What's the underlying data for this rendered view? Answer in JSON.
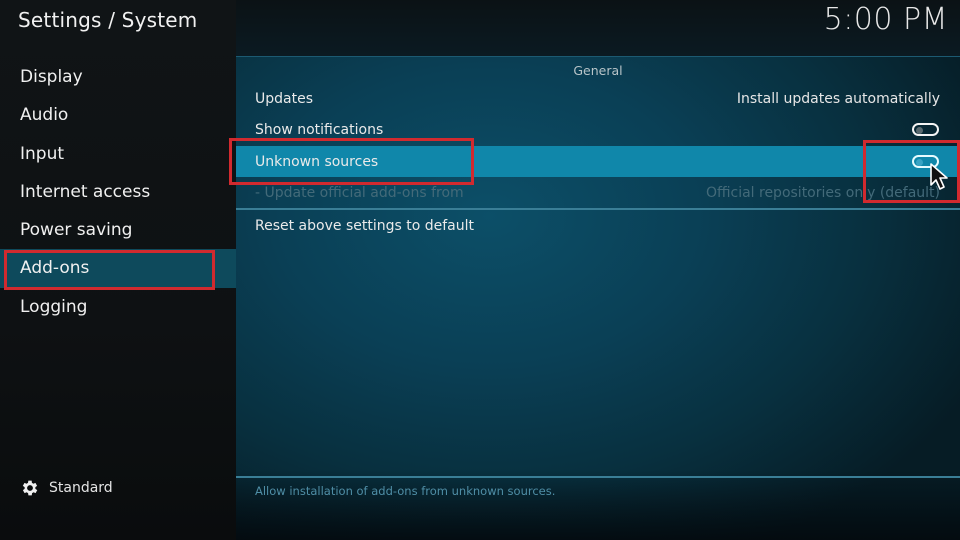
{
  "header": {
    "title": "Settings / System",
    "clock": "5:00 PM"
  },
  "sidebar": {
    "items": [
      {
        "label": "Display",
        "active": false
      },
      {
        "label": "Audio",
        "active": false
      },
      {
        "label": "Input",
        "active": false
      },
      {
        "label": "Internet access",
        "active": false
      },
      {
        "label": "Power saving",
        "active": false
      },
      {
        "label": "Add-ons",
        "active": true
      },
      {
        "label": "Logging",
        "active": false
      }
    ],
    "settings_level": {
      "icon": "gear-icon",
      "label": "Standard"
    }
  },
  "main": {
    "section_header": "General",
    "rows": [
      {
        "label": "Updates",
        "value": "Install updates automatically",
        "type": "select"
      },
      {
        "label": "Show notifications",
        "type": "toggle",
        "on": false
      },
      {
        "label": "Unknown sources",
        "type": "toggle",
        "on": false,
        "focused": true
      },
      {
        "label": "- Update official add-ons from",
        "value": "Official repositories only (default)",
        "type": "select",
        "disabled": true
      },
      {
        "label": "Reset above settings to default",
        "type": "action"
      }
    ],
    "help_text": "Allow installation of add-ons from unknown sources."
  },
  "colors": {
    "focus_row": "#1087aa",
    "active_nav": "#0e4a5c",
    "highlight_box": "#d12a2f"
  }
}
